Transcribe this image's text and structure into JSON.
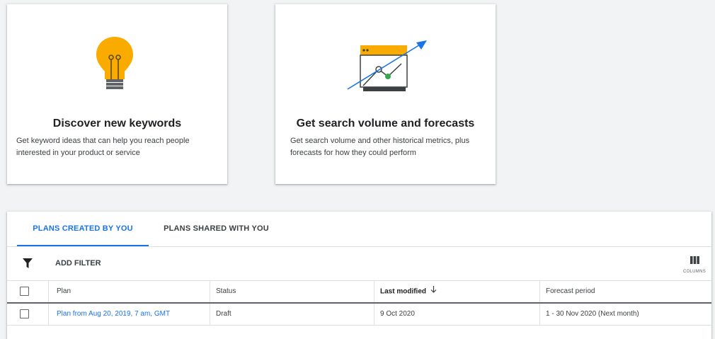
{
  "cards": [
    {
      "title": "Discover new keywords",
      "description": "Get keyword ideas that can help you reach people interested in your product or service",
      "icon": "lightbulb-icon"
    },
    {
      "title": "Get search volume and forecasts",
      "description": "Get search volume and other historical metrics, plus forecasts for how they could perform",
      "icon": "forecast-chart-icon"
    }
  ],
  "tabs": {
    "created": "PLANS CREATED BY YOU",
    "shared": "PLANS SHARED WITH YOU"
  },
  "toolbar": {
    "add_filter": "ADD FILTER",
    "columns": "COLUMNS"
  },
  "table": {
    "headers": {
      "plan": "Plan",
      "status": "Status",
      "last_modified": "Last modified",
      "forecast_period": "Forecast period"
    },
    "rows": [
      {
        "plan": "Plan from Aug 20, 2019, 7 am, GMT",
        "status": "Draft",
        "last_modified": "9 Oct 2020",
        "forecast_period": "1 - 30 Nov 2020 (Next month)"
      }
    ]
  },
  "colors": {
    "accent": "#1a73e8",
    "bulb": "#f9ab00",
    "chart_green": "#34a853"
  }
}
